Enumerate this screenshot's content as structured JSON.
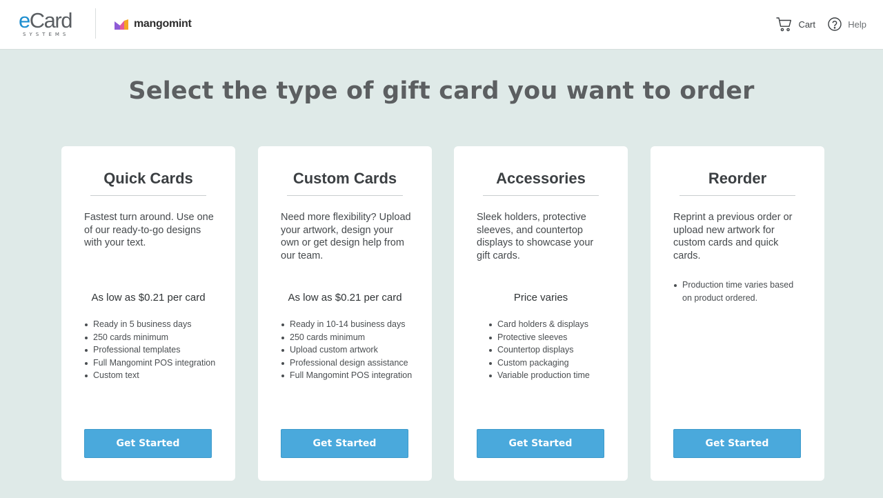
{
  "header": {
    "logo_primary": "eCard",
    "logo_primary_sub": "SYSTEMS",
    "logo_partner": "mangomint",
    "cart_label": "Cart",
    "help_label": "Help"
  },
  "headline": "Select the type of gift card you want to order",
  "colors": {
    "background": "#dfeae8",
    "card": "#ffffff",
    "button": "#4aa9dc",
    "ecard_accent": "#1f8fd0"
  },
  "cards": [
    {
      "title": "Quick Cards",
      "description": "Fastest turn around. Use one of our ready-to-go designs with your text.",
      "price": "As low as $0.21 per card",
      "features": [
        "Ready in 5 business days",
        "250 cards minimum",
        "Professional templates",
        "Full Mangomint POS integration",
        "Custom text"
      ],
      "button": "Get Started"
    },
    {
      "title": "Custom Cards",
      "description": "Need more flexibility? Upload your artwork, design your own or get design help from our team.",
      "price": "As low as $0.21 per card",
      "features": [
        "Ready in 10-14 business days",
        "250 cards minimum",
        "Upload custom artwork",
        "Professional design assistance",
        "Full Mangomint POS integration"
      ],
      "button": "Get Started"
    },
    {
      "title": "Accessories",
      "description": "Sleek holders, protective sleeves, and countertop displays to showcase your gift cards.",
      "price": "Price varies",
      "features": [
        "Card holders & displays",
        "Protective sleeves",
        "Countertop displays",
        "Custom packaging",
        "Variable production time"
      ],
      "button": "Get Started"
    },
    {
      "title": "Reorder",
      "description": "Reprint a previous order or upload new artwork for custom cards and quick cards.",
      "price": "",
      "features": [
        "Production time varies based on product ordered."
      ],
      "button": "Get Started"
    }
  ]
}
